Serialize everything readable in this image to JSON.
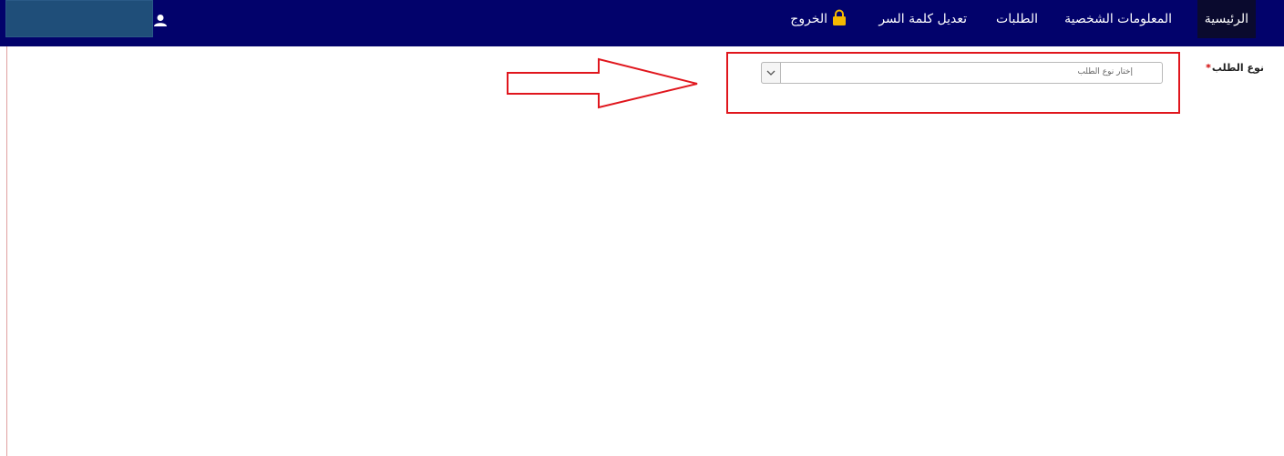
{
  "navbar": {
    "items": [
      {
        "label": "الرئيسية"
      },
      {
        "label": "المعلومات الشخصية"
      },
      {
        "label": "الطلبات"
      },
      {
        "label": "تعديل كلمة السر"
      },
      {
        "label": "الخروج",
        "icon": "lock-icon"
      }
    ],
    "user_icon": "user-icon"
  },
  "form": {
    "request_type": {
      "label": "نوع الطلب",
      "required_mark": "*",
      "placeholder": "إختار نوع الطلب",
      "dropdown_icon": "chevron-down-icon"
    }
  },
  "annotations": {
    "color": "#e0161d"
  },
  "colors": {
    "navbar_bg": "#02026b",
    "user_block_bg": "#1f4e79",
    "accent_lock": "#f5b800"
  }
}
